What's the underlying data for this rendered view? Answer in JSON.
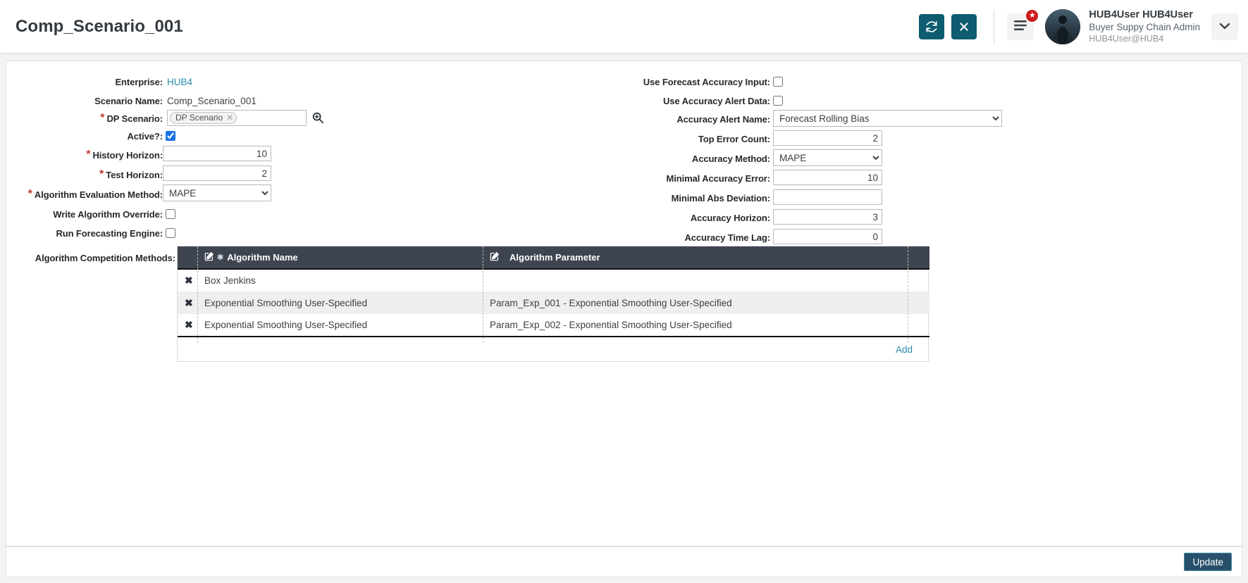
{
  "header": {
    "title": "Comp_Scenario_001",
    "refresh_label": "refresh",
    "close_label": "close",
    "menu_label": "menu",
    "badge_label": "★",
    "user_name": "HUB4User HUB4User",
    "user_role": "Buyer Suppy Chain Admin",
    "user_email": "HUB4User@HUB4",
    "accent_teal": "#0d5c70",
    "badge_color": "#d01b1b"
  },
  "form": {
    "left": {
      "enterprise_label": "Enterprise:",
      "enterprise_value": "HUB4",
      "scenario_name_label": "Scenario Name:",
      "scenario_name_value": "Comp_Scenario_001",
      "dp_scenario_label": "DP Scenario:",
      "dp_scenario_token": "DP Scenario",
      "active_label": "Active?:",
      "active_checked": true,
      "history_horizon_label": "History Horizon:",
      "history_horizon_value": "10",
      "test_horizon_label": "Test Horizon:",
      "test_horizon_value": "2",
      "algorithm_evaluation_method_label": "Algorithm Evaluation Method:",
      "algorithm_evaluation_method_value": "MAPE",
      "write_algorithm_override_label": "Write Algorithm Override:",
      "write_algorithm_override_checked": false,
      "run_forecasting_engine_label": "Run Forecasting Engine:",
      "run_forecasting_engine_checked": false,
      "algorithm_competition_methods_label": "Algorithm Competition Methods:"
    },
    "right": {
      "use_forecast_accuracy_input_label": "Use Forecast Accuracy Input:",
      "use_forecast_accuracy_input_checked": false,
      "use_accuracy_alert_data_label": "Use Accuracy Alert Data:",
      "use_accuracy_alert_data_checked": false,
      "accuracy_alert_name_label": "Accuracy Alert Name:",
      "accuracy_alert_name_value": "Forecast Rolling Bias",
      "top_error_count_label": "Top Error Count:",
      "top_error_count_value": "2",
      "accuracy_method_label": "Accuracy Method:",
      "accuracy_method_value": "MAPE",
      "minimal_accuracy_error_label": "Minimal Accuracy Error:",
      "minimal_accuracy_error_value": "10",
      "minimal_abs_deviation_label": "Minimal Abs Deviation:",
      "minimal_abs_deviation_value": "",
      "accuracy_horizon_label": "Accuracy Horizon:",
      "accuracy_horizon_value": "3",
      "accuracy_time_lag_label": "Accuracy Time Lag:",
      "accuracy_time_lag_value": "0"
    }
  },
  "table": {
    "columns": [
      {
        "key": "algorithm_name",
        "label": "Algorithm Name",
        "icon": "edit-icon",
        "required": true
      },
      {
        "key": "algorithm_parameter",
        "label": "Algorithm Parameter",
        "icon": "edit-icon",
        "required": false
      }
    ],
    "rows": [
      {
        "delete": "✖",
        "algorithm_name": "Box Jenkins",
        "algorithm_parameter": ""
      },
      {
        "delete": "✖",
        "algorithm_name": "Exponential Smoothing User-Specified",
        "algorithm_parameter": "Param_Exp_001 - Exponential Smoothing User-Specified"
      },
      {
        "delete": "✖",
        "algorithm_name": "Exponential Smoothing User-Specified",
        "algorithm_parameter": "Param_Exp_002 - Exponential Smoothing User-Specified"
      }
    ],
    "add_label": "Add"
  },
  "footer": {
    "update_label": "Update"
  }
}
